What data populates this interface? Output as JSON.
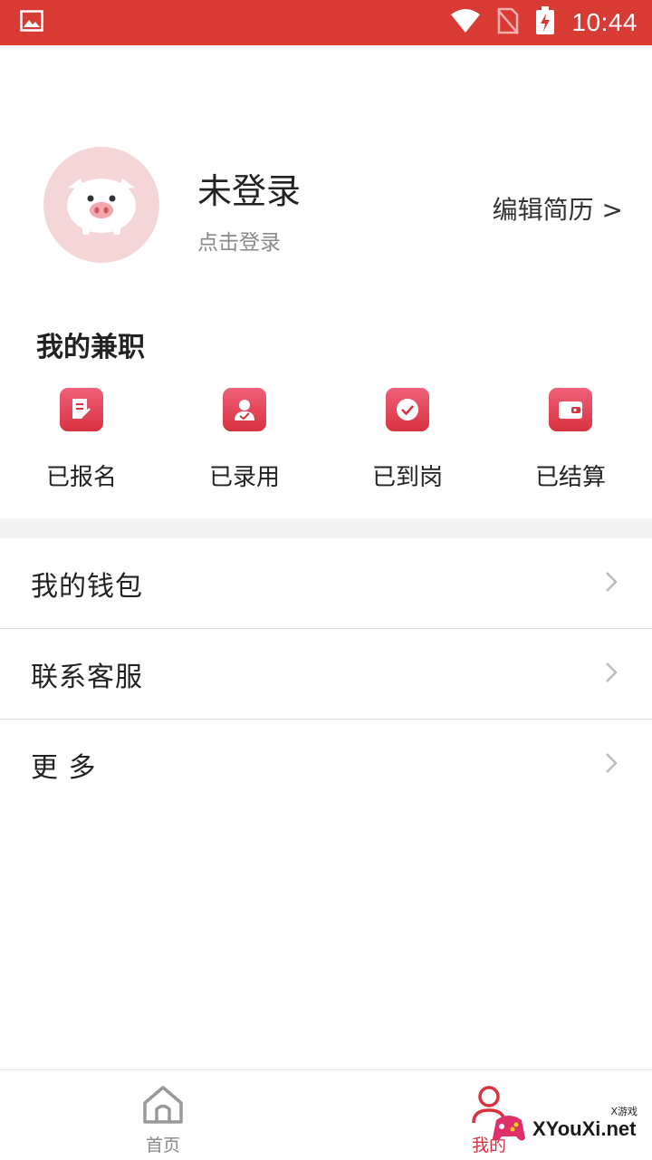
{
  "status_bar": {
    "time": "10:44"
  },
  "profile": {
    "name": "未登录",
    "subtitle": "点击登录",
    "edit_resume": "编辑简历 >"
  },
  "my_jobs": {
    "title": "我的兼职",
    "items": [
      {
        "label": "已报名",
        "icon": "document-icon"
      },
      {
        "label": "已录用",
        "icon": "person-check-icon"
      },
      {
        "label": "已到岗",
        "icon": "check-circle-icon"
      },
      {
        "label": "已结算",
        "icon": "wallet-icon"
      }
    ]
  },
  "menu": [
    {
      "label": "我的钱包"
    },
    {
      "label": "联系客服"
    },
    {
      "label": "更 多"
    }
  ],
  "bottom_nav": {
    "home": "首页",
    "mine": "我的"
  },
  "watermark": {
    "text": "XYouXi.net",
    "small": "X游戏"
  },
  "colors": {
    "brand": "#d83a34",
    "accent": "#d8323f"
  }
}
